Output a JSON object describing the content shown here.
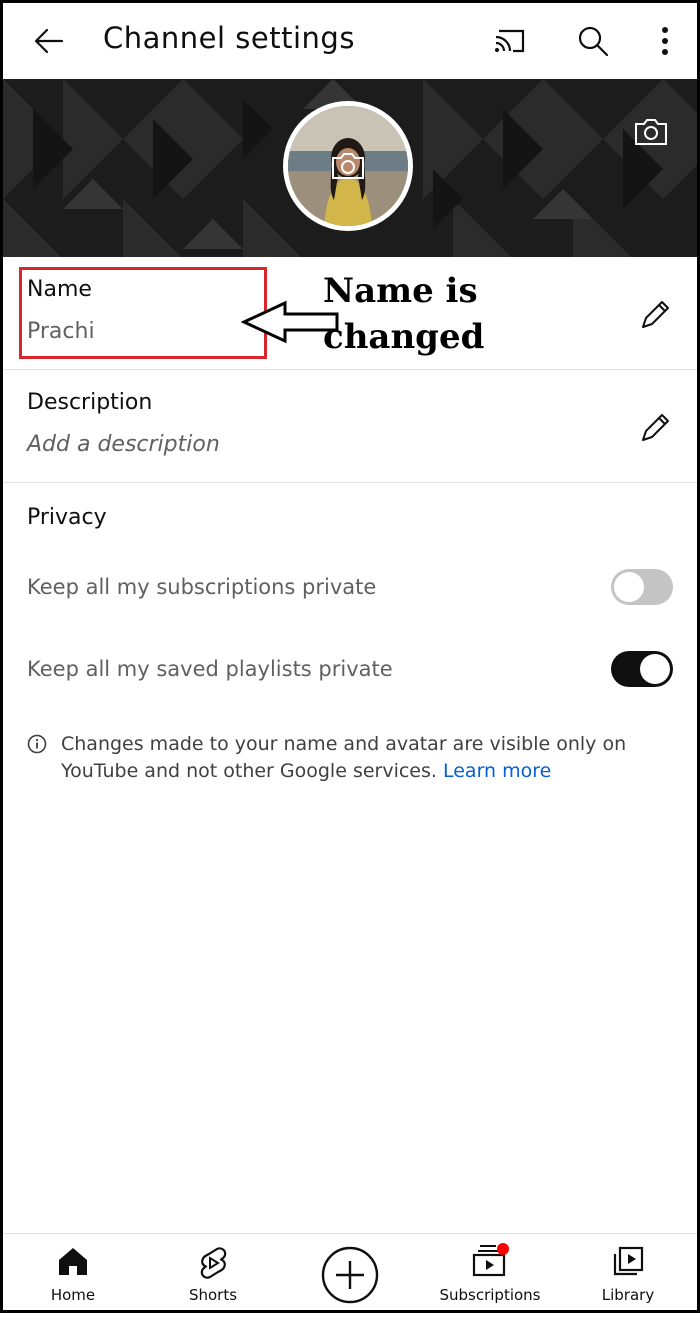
{
  "header": {
    "title": "Channel settings",
    "back_icon": "arrow-left-icon",
    "cast_icon": "cast-icon",
    "search_icon": "search-icon",
    "more_icon": "more-vert-icon"
  },
  "banner": {
    "avatar_camera_icon": "camera-icon",
    "banner_camera_icon": "camera-icon"
  },
  "name_field": {
    "label": "Name",
    "value": "Prachi"
  },
  "description_field": {
    "label": "Description",
    "placeholder": "Add a description"
  },
  "privacy": {
    "heading": "Privacy",
    "items": [
      {
        "label": "Keep all my subscriptions private",
        "enabled": false
      },
      {
        "label": "Keep all my saved playlists private",
        "enabled": true
      }
    ]
  },
  "info": {
    "text": "Changes made to your name and avatar are visible only on YouTube and not other Google services.",
    "link": "Learn more"
  },
  "annotation": {
    "text_line1": "Name is",
    "text_line2": "changed"
  },
  "bottom_nav": [
    {
      "label": "Home",
      "icon": "home-icon"
    },
    {
      "label": "Shorts",
      "icon": "shorts-icon"
    },
    {
      "label": "",
      "icon": "create-plus-icon"
    },
    {
      "label": "Subscriptions",
      "icon": "subscriptions-icon"
    },
    {
      "label": "Library",
      "icon": "library-icon"
    }
  ],
  "colors": {
    "accent_link": "#065fd4",
    "annotation_border": "#d8262b",
    "notification_dot": "#ff0000",
    "toggle_on": "#0f0f0f",
    "toggle_off": "#c4c4c4"
  }
}
